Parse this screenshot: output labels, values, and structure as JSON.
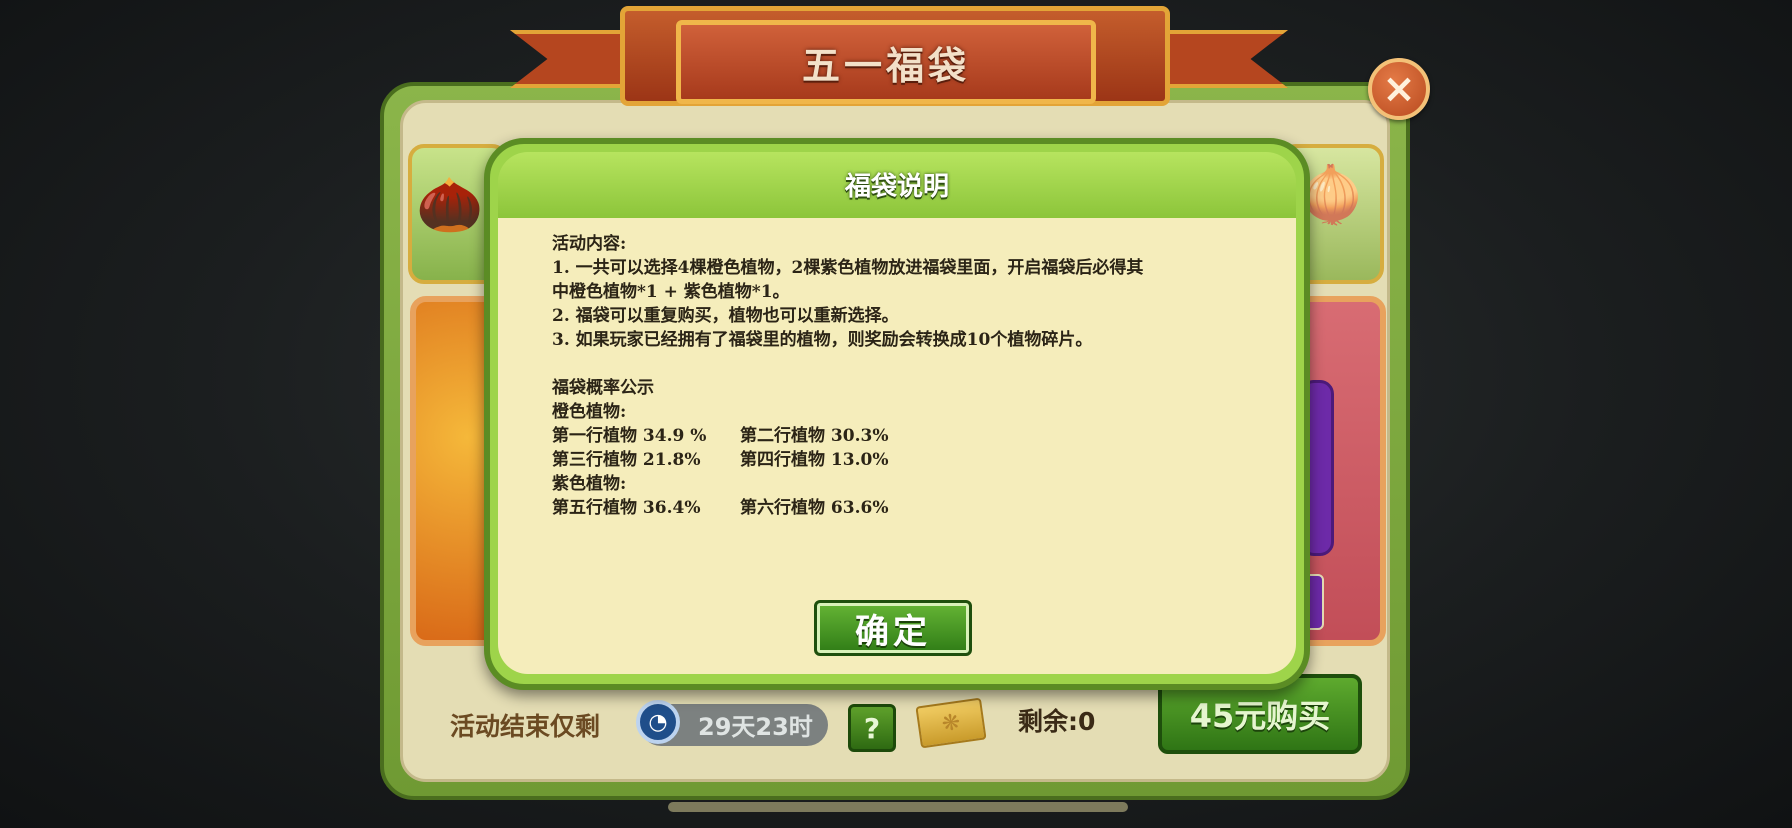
{
  "banner": {
    "title": "五一福袋"
  },
  "close_icon": "×",
  "bottom_bar": {
    "activity_end_label": "活动结束仅剩",
    "timer": "29天23时",
    "help_label": "?",
    "remaining_label": "剩余:0",
    "buy_label": "45元购买"
  },
  "modal": {
    "title": "福袋说明",
    "lines": [
      "活动内容:",
      "1. 一共可以选择4棵橙色植物，2棵紫色植物放进福袋里面，开启福袋后必得其",
      "中橙色植物*1 + 紫色植物*1。",
      "2. 福袋可以重复购买，植物也可以重新选择。",
      "3. 如果玩家已经拥有了福袋里的植物，则奖励会转换成10个植物碎片。",
      "福袋概率公示",
      "橙色植物:",
      "紫色植物:"
    ],
    "orange_rows": [
      {
        "a": "第一行植物 34.9 %",
        "b": "第二行植物  30.3%"
      },
      {
        "a": "第三行植物 21.8%",
        "b": "第四行植物  13.0%"
      }
    ],
    "purple_rows": [
      {
        "a": "第五行植物 36.4%",
        "b": "第六行植物  63.6%"
      }
    ],
    "ok_label": "确定"
  }
}
